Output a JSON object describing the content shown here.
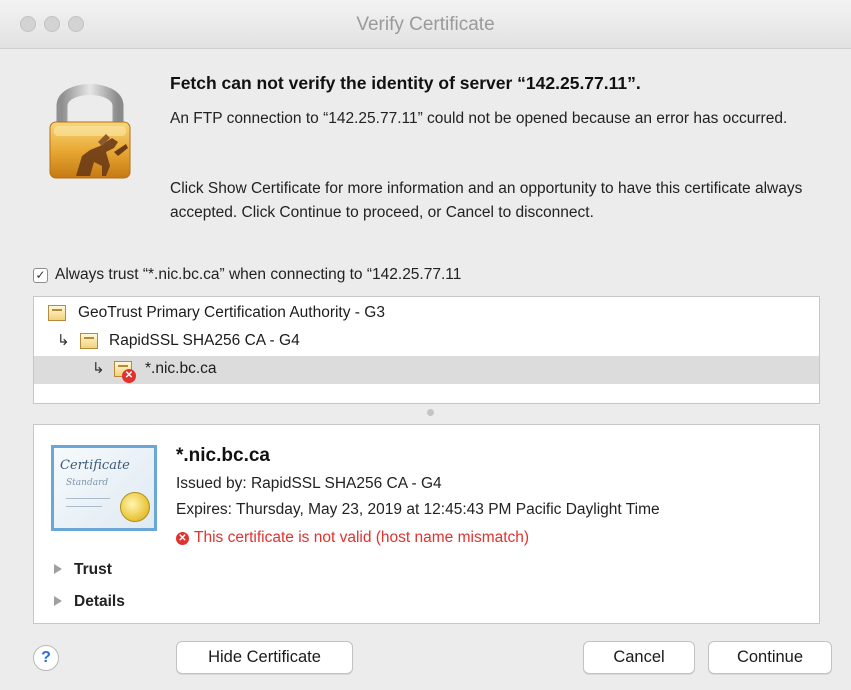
{
  "window": {
    "title": "Verify Certificate"
  },
  "message": {
    "heading": "Fetch can not verify the identity of server “142.25.77.11”.",
    "para1": "An FTP connection to “142.25.77.11” could not be opened because an error has occurred.",
    "para2": "Click Show Certificate for more information and an opportunity to have this certificate always accepted.  Click Continue to proceed, or Cancel to disconnect."
  },
  "trust_checkbox": {
    "checked": true,
    "label": "Always trust “*.nic.bc.ca” when connecting to “142.25.77.11"
  },
  "chain": [
    {
      "label": "GeoTrust Primary Certification Authority - G3",
      "level": 0,
      "invalid": false,
      "selected": false
    },
    {
      "label": "RapidSSL SHA256 CA - G4",
      "level": 1,
      "invalid": false,
      "selected": false
    },
    {
      "label": "*.nic.bc.ca",
      "level": 2,
      "invalid": true,
      "selected": true
    }
  ],
  "detail": {
    "cert_image_word": "Certificate",
    "cert_image_sub": "Standard",
    "name": "*.nic.bc.ca",
    "issued_by": "Issued by: RapidSSL SHA256 CA - G4",
    "expires": "Expires: Thursday, May 23, 2019 at 12:45:43 PM Pacific Daylight Time",
    "error": "This certificate is not valid (host name mismatch)",
    "trust_label": "Trust",
    "details_label": "Details"
  },
  "buttons": {
    "help": "?",
    "hide_certificate": "Hide Certificate",
    "cancel": "Cancel",
    "continue": "Continue"
  },
  "colors": {
    "error": "#e0322f",
    "selection": "#dcdcdc",
    "window_bg": "#ececec"
  }
}
